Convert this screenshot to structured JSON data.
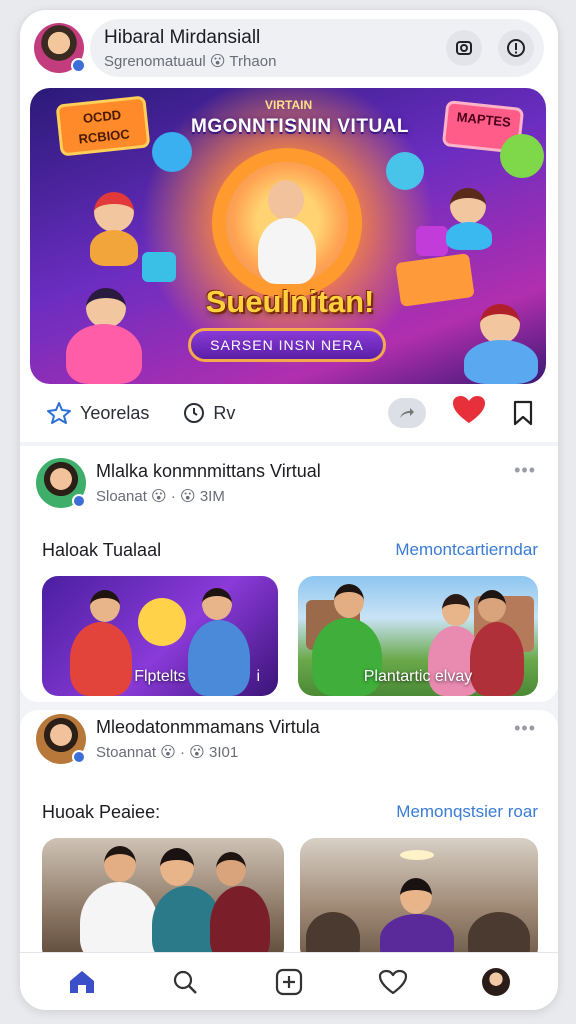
{
  "header": {
    "title": "Hibaral Mirdansiall",
    "subtitle": "Sgrenomatuaul 😮 Trhaon",
    "camera_icon": "camera-icon",
    "info_icon": "info-icon"
  },
  "hero": {
    "small_top": "VIRTAIN",
    "top_text": "MGONNTISNIN VITUAL",
    "sign_left": "OCDD RCBIOC",
    "sign_right": "MAPTES",
    "main_text": "Sueulnitan!",
    "cta": "SARSEN INSN NERA"
  },
  "actions": {
    "item1_label": "Yeorelas",
    "item1_icon": "star-icon",
    "item2_label": "Rv",
    "item2_icon": "clock-icon",
    "colors": {
      "heart": "#e8303a",
      "link": "#3a7bd5"
    }
  },
  "posts": [
    {
      "title": "Mlalka konmnmittans Virtual",
      "subtitle": "Sloanat 😮 · 😮 3IM",
      "section_title": "Haloak Tualaal",
      "section_link": "Memontcartierndar",
      "cards": [
        {
          "label": "Flptelts",
          "extra": "i"
        },
        {
          "label": "Plantartic elvay",
          "extra": ""
        }
      ]
    },
    {
      "title": "Mleodatonmmamans Virtula",
      "subtitle": "Stoannat 😮 · 😮 3I01",
      "section_title": "Huoak Peaiee:",
      "section_link": "Memonqstsier roar",
      "cards": [
        {
          "label": "",
          "extra": ""
        },
        {
          "label": "",
          "extra": ""
        }
      ]
    }
  ],
  "nav": {
    "items": [
      "home-icon",
      "search-icon",
      "add-icon",
      "heart-icon",
      "profile-avatar"
    ]
  }
}
